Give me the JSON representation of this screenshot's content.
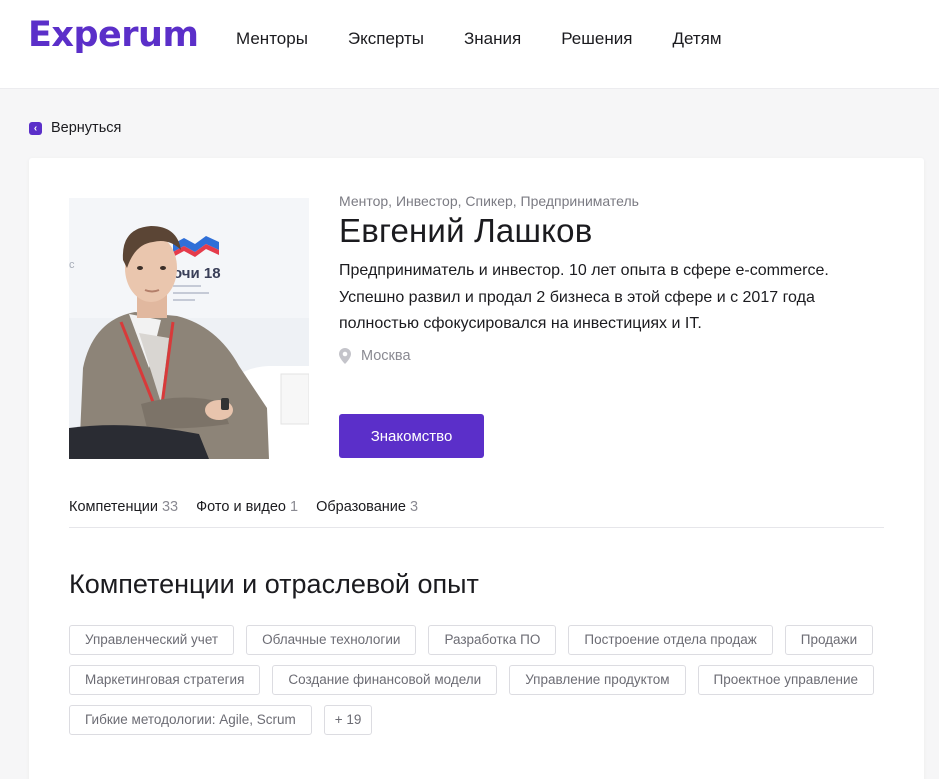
{
  "header": {
    "logo": "Experum",
    "nav": [
      "Менторы",
      "Эксперты",
      "Знания",
      "Решения",
      "Детям"
    ]
  },
  "back_label": "Вернуться",
  "profile": {
    "roles": "Ментор, Инвестор, Спикер, Предприниматель",
    "name": "Евгений Лашков",
    "bio": "Предприниматель и инвестор. 10 лет опыта в сфере e-commerce. Успешно развил и продал 2 бизнеса в этой сфере и с 2017 года полностью сфокусировался на инвестициях и IT.",
    "location": "Москва",
    "cta_label": "Знакомство",
    "photo_text": {
      "event_label": "очи 18",
      "left_fragment": "с"
    }
  },
  "tabs": [
    {
      "label": "Компетенции",
      "count": "33"
    },
    {
      "label": "Фото и видео",
      "count": "1"
    },
    {
      "label": "Образование",
      "count": "3"
    }
  ],
  "section_title": "Компетенции и отраслевой опыт",
  "tags": [
    [
      "Управленческий учет",
      "Облачные технологии",
      "Разработка ПО",
      "Построение отдела продаж",
      "Продажи"
    ],
    [
      "Маркетинговая стратегия",
      "Создание финансовой модели",
      "Управление продуктом",
      "Проектное управление"
    ],
    [
      "Гибкие методологии: Agile, Scrum",
      "+ 19"
    ]
  ],
  "colors": {
    "brand": "#5b2fc9",
    "page_background": "#f6f6f7",
    "muted_text": "#8a8a92"
  },
  "icons": {
    "back": "chevron-left-icon",
    "location": "map-pin-icon"
  }
}
